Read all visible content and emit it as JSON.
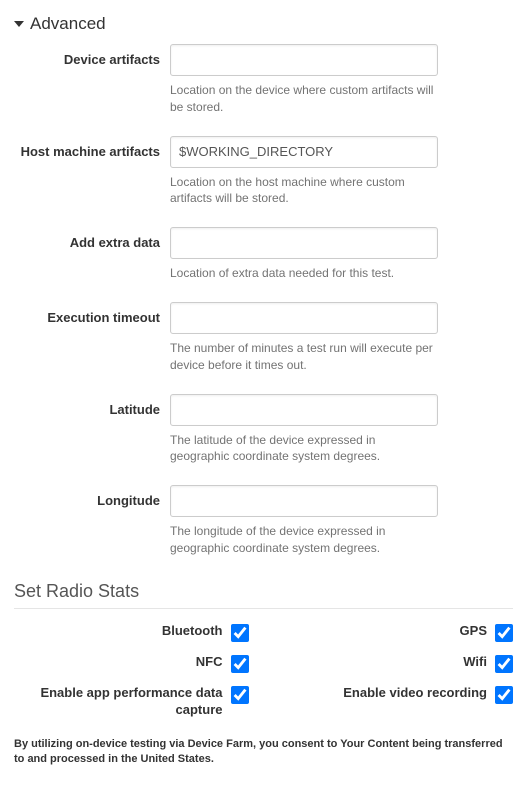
{
  "advanced": {
    "header": "Advanced",
    "fields": {
      "device_artifacts": {
        "label": "Device artifacts",
        "value": "",
        "help": "Location on the device where custom artifacts will be stored."
      },
      "host_machine_artifacts": {
        "label": "Host machine artifacts",
        "value": "$WORKING_DIRECTORY",
        "help": "Location on the host machine where custom artifacts will be stored."
      },
      "add_extra_data": {
        "label": "Add extra data",
        "value": "",
        "help": "Location of extra data needed for this test."
      },
      "execution_timeout": {
        "label": "Execution timeout",
        "value": "",
        "help": "The number of minutes a test run will execute per device before it times out."
      },
      "latitude": {
        "label": "Latitude",
        "value": "",
        "help": "The latitude of the device expressed in geographic coordinate system degrees."
      },
      "longitude": {
        "label": "Longitude",
        "value": "",
        "help": "The longitude of the device expressed in geographic coordinate system degrees."
      }
    }
  },
  "radio_stats": {
    "header": "Set Radio Stats",
    "options": {
      "bluetooth": {
        "label": "Bluetooth",
        "checked": true
      },
      "gps": {
        "label": "GPS",
        "checked": true
      },
      "nfc": {
        "label": "NFC",
        "checked": true
      },
      "wifi": {
        "label": "Wifi",
        "checked": true
      },
      "perf_capture": {
        "label": "Enable app performance data capture",
        "checked": true
      },
      "video_recording": {
        "label": "Enable video recording",
        "checked": true
      }
    }
  },
  "consent_text": "By utilizing on-device testing via Device Farm, you consent to Your Content being transferred to and processed in the United States."
}
